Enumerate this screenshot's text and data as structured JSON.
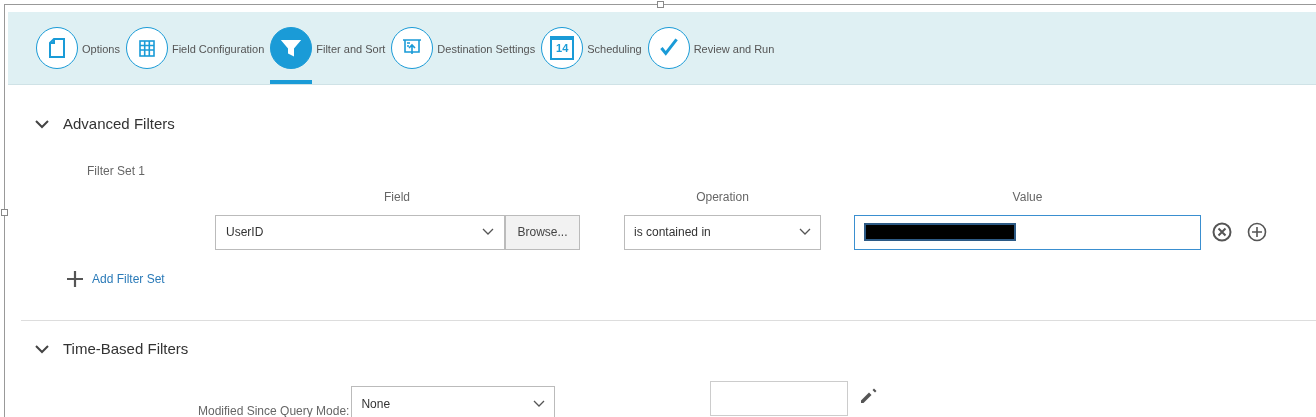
{
  "steps": [
    {
      "label": "Options",
      "kind": "document",
      "selected": false
    },
    {
      "label": "Field Configuration",
      "kind": "grid",
      "selected": false
    },
    {
      "label": "Filter and Sort",
      "kind": "funnel",
      "selected": true
    },
    {
      "label": "Destination Settings",
      "kind": "upload",
      "selected": false
    },
    {
      "label": "Scheduling",
      "kind": "calendar",
      "icon_text": "14",
      "selected": false
    },
    {
      "label": "Review and Run",
      "kind": "check",
      "selected": false
    }
  ],
  "advanced_filters": {
    "title": "Advanced Filters",
    "expanded": true,
    "filter_set_label": "Filter Set 1",
    "columns": [
      "Field",
      "Operation",
      "Value"
    ],
    "row": {
      "field": "UserID",
      "browse_button": "Browse...",
      "operation": "is contained in",
      "value_redacted": true
    },
    "add_link": "Add Filter Set"
  },
  "time_based_filters": {
    "title": "Time-Based Filters",
    "expanded": true,
    "mode_label": "Modified Since Query Mode:",
    "mode_value": "None"
  }
}
